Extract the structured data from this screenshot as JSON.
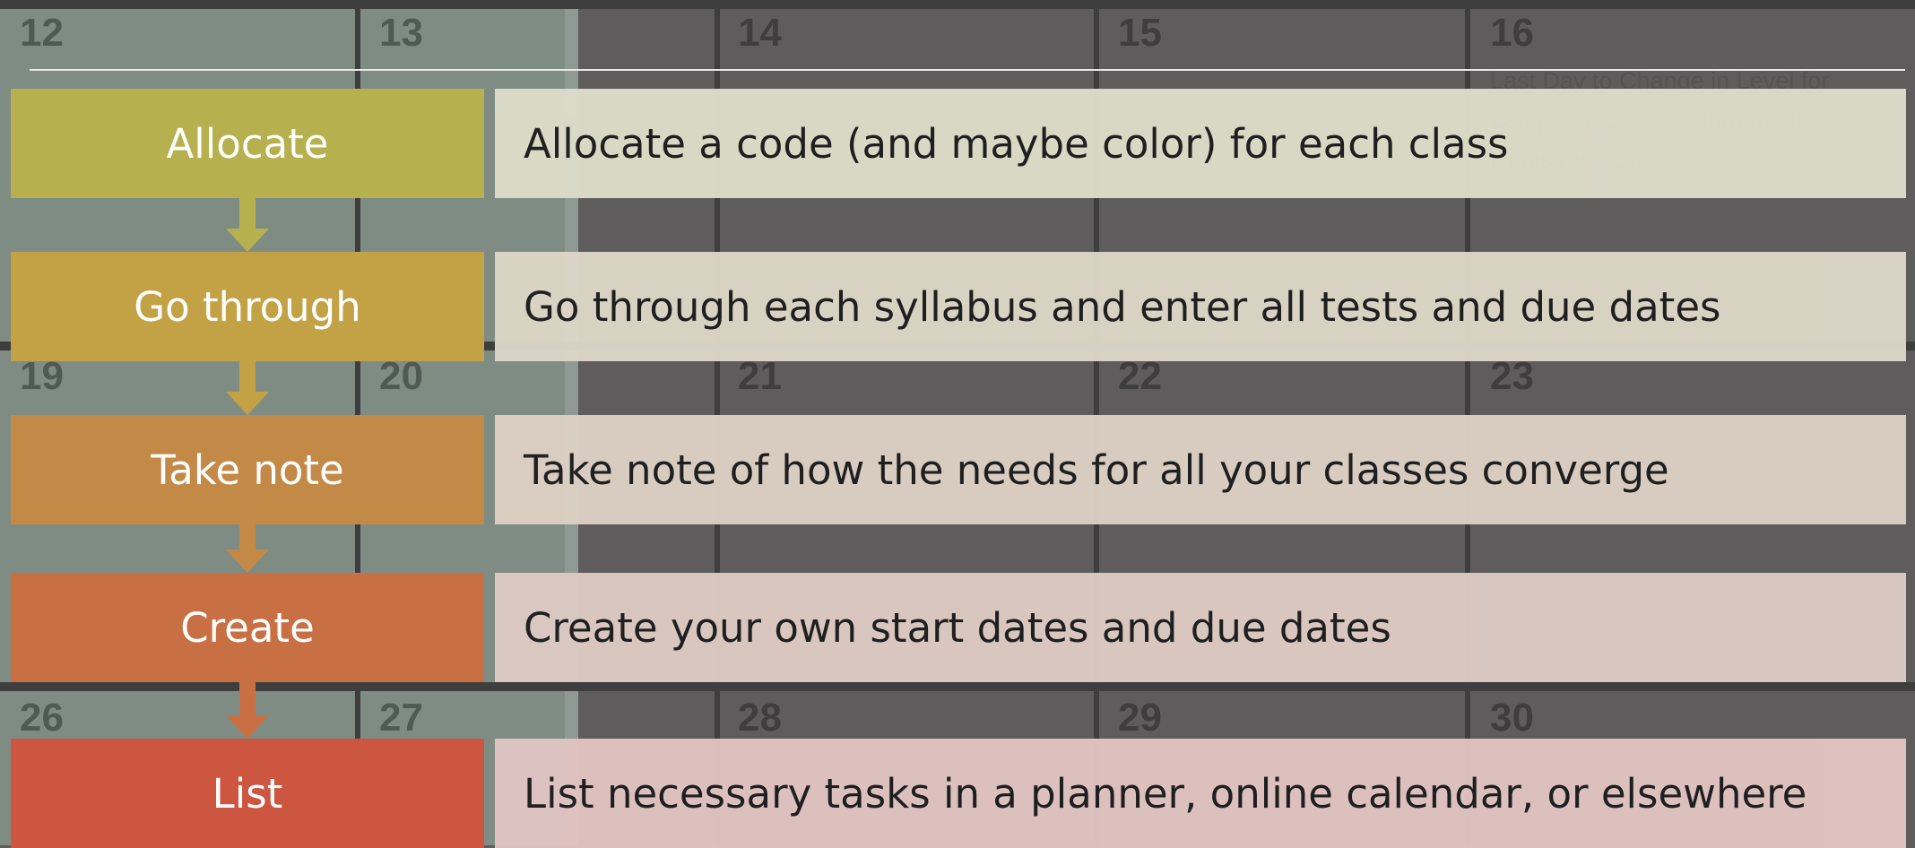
{
  "calendar": {
    "day_numbers": {
      "row1": [
        "12",
        "13",
        "14",
        "15",
        "16"
      ],
      "row2": [
        "19",
        "20",
        "21",
        "22",
        "23"
      ],
      "row3": [
        "26",
        "27",
        "28",
        "29",
        "30"
      ]
    },
    "event_text": "Last Day to Change in Level for Language Courses through the Registrar's Office"
  },
  "steps": [
    {
      "label": "Allocate",
      "description": "Allocate a code (and maybe color) for each class",
      "color": "#b7b04f",
      "desc_color": "#dcdcc9"
    },
    {
      "label": "Go through",
      "description": "Go through each syllabus and enter all tests and due dates",
      "color": "#c3a245",
      "desc_color": "#dcd6c7"
    },
    {
      "label": "Take note",
      "description": "Take note of how the needs for all your classes converge",
      "color": "#c38a47",
      "desc_color": "#dcd0c4"
    },
    {
      "label": "Create",
      "description": "Create your own start dates and due dates",
      "color": "#c87044",
      "desc_color": "#dccac3"
    },
    {
      "label": "List",
      "description": "List necessary tasks in a planner, online calendar, or elsewhere",
      "color": "#cd5640",
      "desc_color": "#e0c4c2"
    }
  ]
}
